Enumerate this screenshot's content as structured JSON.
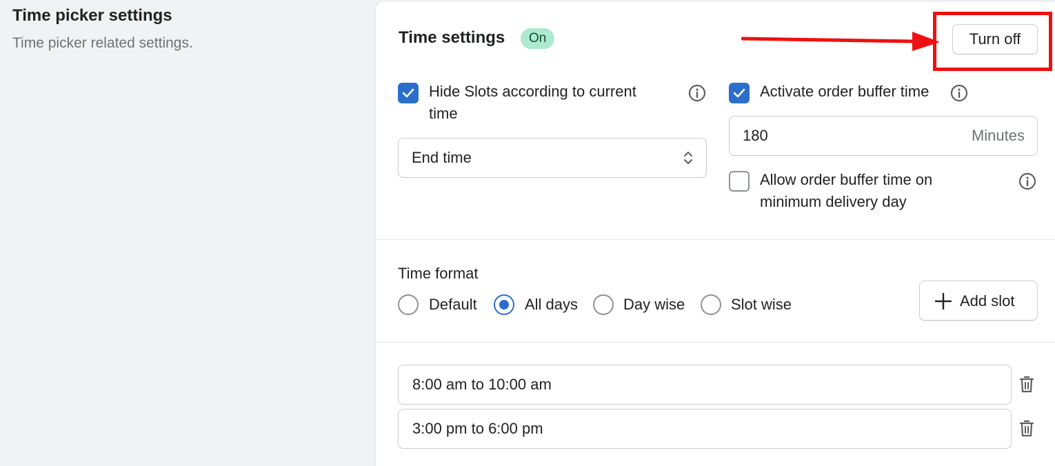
{
  "left": {
    "title": "Time picker settings",
    "description": "Time picker related settings."
  },
  "card": {
    "title": "Time settings",
    "status_badge": "On",
    "turn_off_label": "Turn off",
    "hide_slots": {
      "checked": true,
      "label_line1": "Hide Slots according to current",
      "label_line2": "time"
    },
    "hide_slots_select": {
      "selected": "End time"
    },
    "order_buffer": {
      "checked": true,
      "label": "Activate order buffer time"
    },
    "buffer_input": {
      "value": "180",
      "suffix": "Minutes"
    },
    "allow_buffer_min_day": {
      "checked": false,
      "label_line1": "Allow order buffer time on",
      "label_line2": "minimum delivery day"
    },
    "time_format": {
      "label": "Time format",
      "options": [
        "Default",
        "All days",
        "Day wise",
        "Slot wise"
      ],
      "selected": "All days"
    },
    "add_slot_label": "Add slot",
    "slots": [
      "8:00 am to 10:00 am",
      "3:00 pm to 6:00 pm"
    ]
  },
  "annotation": {
    "highlight_color": "#ee1111"
  },
  "colors": {
    "accent": "#2c6ecb",
    "badge_bg": "#aee9d1",
    "badge_text": "#0c5132"
  },
  "icons": [
    "checkmark-icon",
    "info-icon",
    "select-chevron-icon",
    "plus-icon",
    "trash-icon",
    "arrow-annotation"
  ]
}
